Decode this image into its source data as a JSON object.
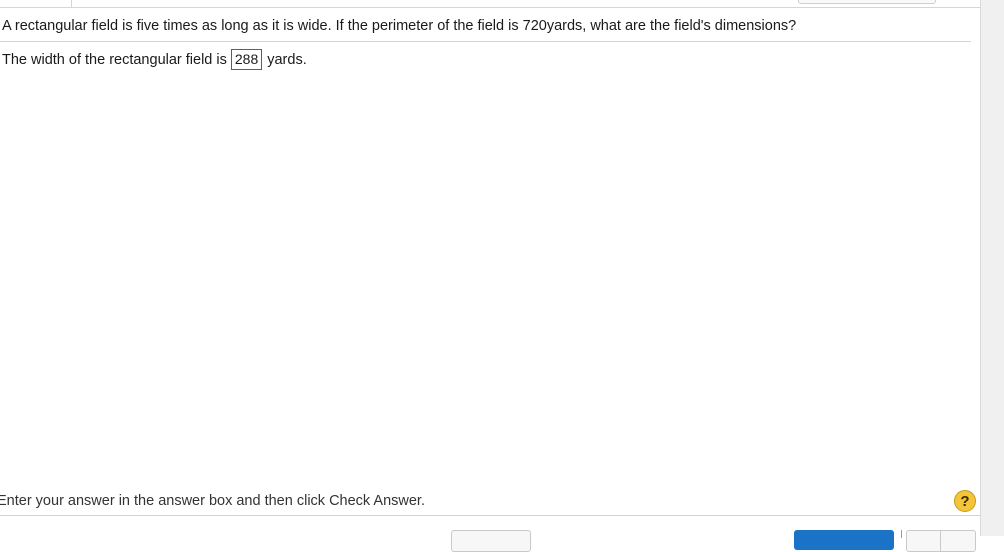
{
  "question": {
    "text": "A rectangular field is five times as long as it is wide. If the perimeter of the field is 720yards, what are the field's dimensions?"
  },
  "answer": {
    "prefix": "The width of the rectangular field is",
    "value": "288",
    "suffix": "yards."
  },
  "instruction": {
    "text": "Enter your answer in the answer box and then click Check Answer."
  },
  "help": {
    "label": "?",
    "icon": "help-icon",
    "color": "#f4c43b"
  },
  "colors": {
    "accent": "#1a73c6",
    "answer_border": "#2b6aa8"
  }
}
